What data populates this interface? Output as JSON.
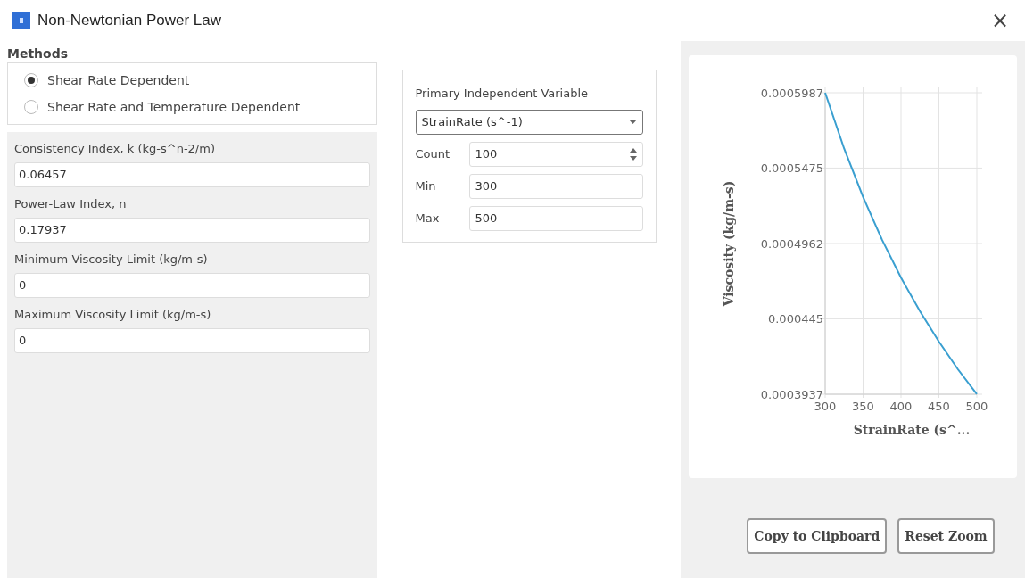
{
  "window": {
    "title": "Non-Newtonian Power Law",
    "close": "×"
  },
  "methods": {
    "title": "Methods",
    "options": [
      {
        "label": "Shear Rate Dependent",
        "selected": true
      },
      {
        "label": "Shear Rate and Temperature Dependent",
        "selected": false
      }
    ]
  },
  "properties": [
    {
      "label": "Consistency Index, k (kg-s^n-2/m)",
      "value": "0.06457"
    },
    {
      "label": "Power-Law Index, n",
      "value": "0.17937"
    },
    {
      "label": "Minimum Viscosity Limit (kg/m-s)",
      "value": "0"
    },
    {
      "label": "Maximum Viscosity Limit (kg/m-s)",
      "value": "0"
    }
  ],
  "variable": {
    "title": "Primary Independent Variable",
    "dropdown": "StrainRate (s^-1)",
    "fields": [
      {
        "kind": "spinner",
        "label": "Count",
        "value": "100"
      },
      {
        "kind": "text",
        "label": "Min",
        "value": "300"
      },
      {
        "kind": "text",
        "label": "Max",
        "value": "500"
      }
    ]
  },
  "plot": {
    "chart_data": {
      "type": "line",
      "xlabel": "StrainRate (s^...",
      "ylabel": "Viscosity (kg/m-s)",
      "x": [
        300,
        325,
        350,
        375,
        400,
        425,
        450,
        475,
        500
      ],
      "grid": true,
      "series": [
        {
          "color": "#3a9fd0",
          "values": [
            0.0005987,
            0.0005607,
            0.0005278,
            0.0004987,
            0.000473,
            0.0004501,
            0.0004295,
            0.0004107,
            0.0003938
          ]
        }
      ],
      "xlim": [
        300,
        500
      ],
      "ylim": [
        0.0003937,
        0.0005987
      ],
      "xticks": [
        300,
        350,
        400,
        450,
        500
      ],
      "yticks": [
        0.0003937,
        0.000445,
        0.0004962,
        0.0005475,
        0.0005987
      ]
    }
  },
  "buttons": [
    "Copy to Clipboard",
    "Reset Zoom"
  ]
}
